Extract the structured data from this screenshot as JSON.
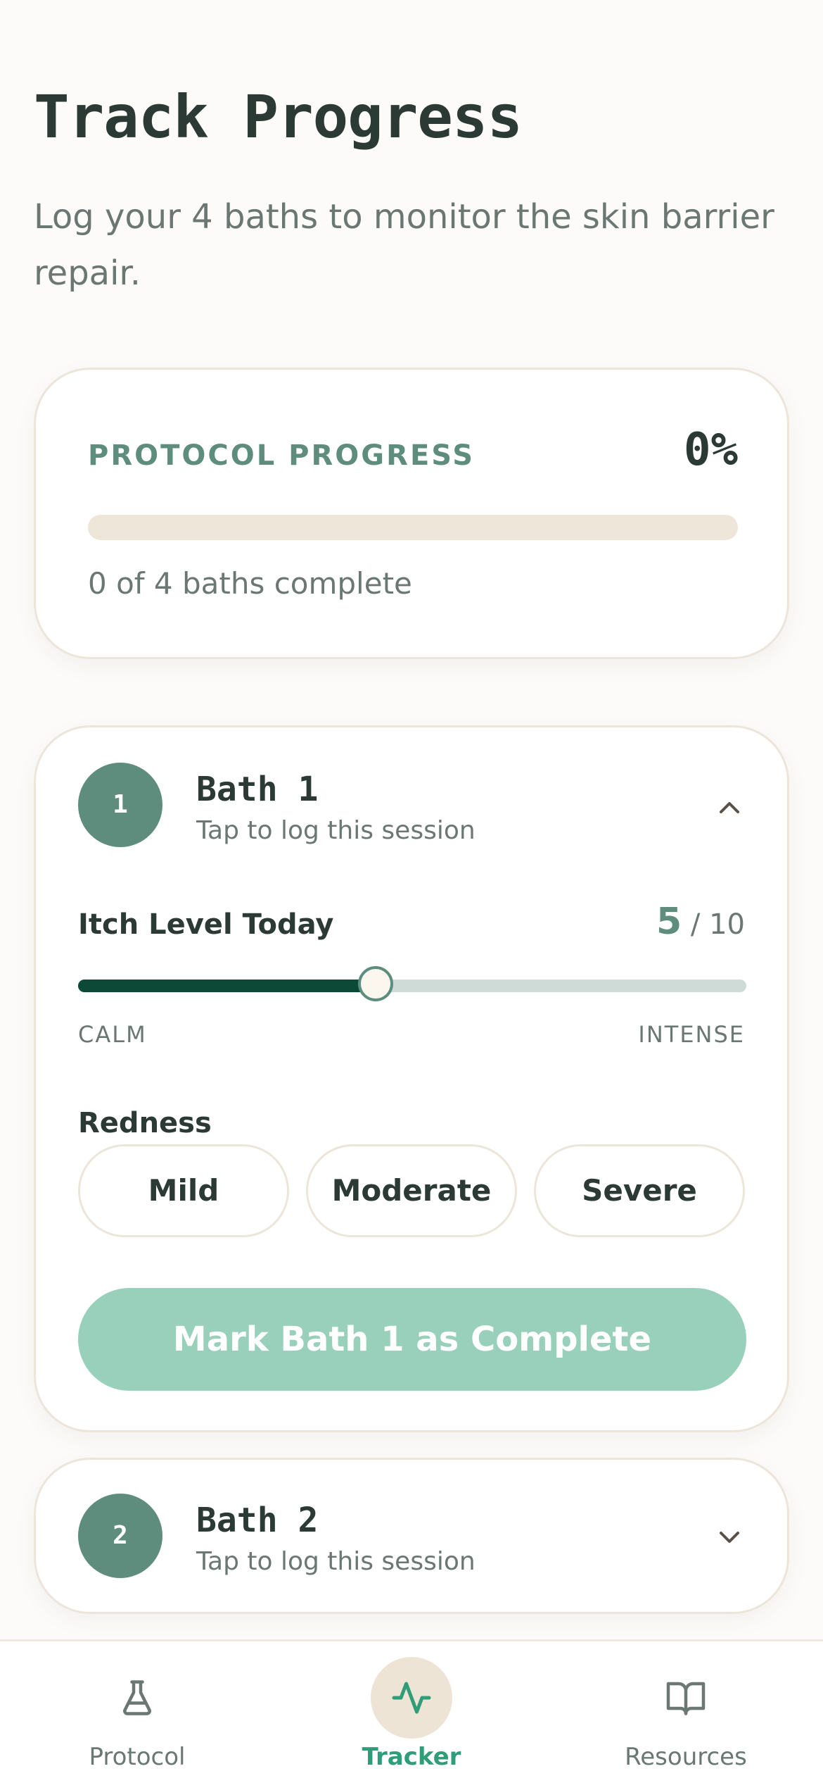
{
  "header": {
    "title": "Track Progress",
    "subtitle": "Log your 4 baths to monitor the skin barrier repair."
  },
  "progress": {
    "label": "PROTOCOL PROGRESS",
    "percent_text": "0%",
    "value_percent": 0,
    "count_text": "0 of 4 baths complete"
  },
  "baths": [
    {
      "number": "1",
      "title": "Bath 1",
      "subtitle": "Tap to log this session",
      "expanded": true,
      "itch": {
        "label": "Itch Level Today",
        "value": "5",
        "max_text": "/ 10",
        "value_number": 5,
        "max_number": 10,
        "min_label": "CALM",
        "max_label": "INTENSE"
      },
      "redness": {
        "label": "Redness",
        "options": [
          "Mild",
          "Moderate",
          "Severe"
        ]
      },
      "complete_button": "Mark Bath 1 as Complete"
    },
    {
      "number": "2",
      "title": "Bath 2",
      "subtitle": "Tap to log this session",
      "expanded": false
    }
  ],
  "nav": {
    "items": [
      {
        "label": "Protocol",
        "icon": "flask-icon",
        "active": false
      },
      {
        "label": "Tracker",
        "icon": "activity-icon",
        "active": true
      },
      {
        "label": "Resources",
        "icon": "book-icon",
        "active": false
      }
    ]
  },
  "colors": {
    "accent": "#5E8D7E",
    "active_nav": "#2F9E78",
    "button_disabled": "#98D0BC",
    "slider_fill": "#0C4A37",
    "background": "#FCFBF9"
  }
}
